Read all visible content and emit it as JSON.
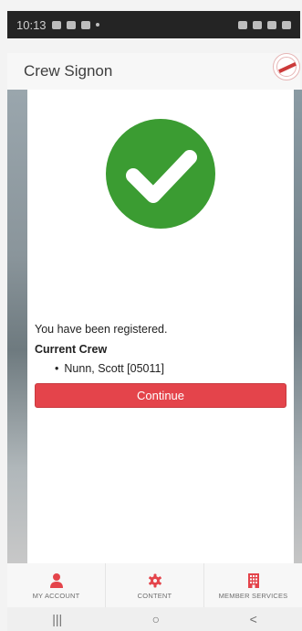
{
  "status_bar": {
    "time": "10:13"
  },
  "header": {
    "title": "Crew Signon"
  },
  "card": {
    "message": "You have been registered.",
    "crew_heading": "Current Crew",
    "crew": [
      "Nunn, Scott [05011]"
    ],
    "continue_label": "Continue"
  },
  "tabs": [
    {
      "label": "MY ACCOUNT",
      "icon": "person-icon"
    },
    {
      "label": "CONTENT",
      "icon": "gear-icon"
    },
    {
      "label": "MEMBER SERVICES",
      "icon": "building-icon"
    }
  ],
  "nav": {
    "recents": "|||",
    "home": "○",
    "back": "<"
  },
  "colors": {
    "accent": "#e4444b",
    "success": "#3b9c32"
  }
}
